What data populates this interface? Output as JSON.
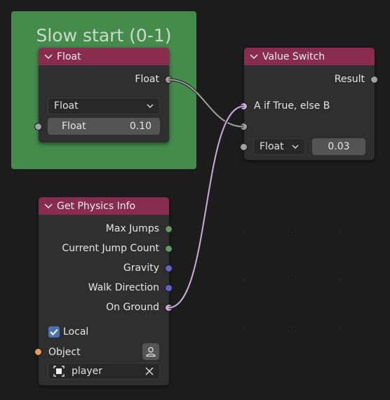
{
  "frame": {
    "title": "Slow start (0-1)"
  },
  "float_node": {
    "title": "Float",
    "output_label": "Float",
    "type_select": "Float",
    "value_label": "Float",
    "value": "0.10"
  },
  "value_switch": {
    "title": "Value Switch",
    "output_label": "Result",
    "input_a_label": "A if True, else B",
    "type_select": "Float",
    "value": "0.03"
  },
  "physics": {
    "title": "Get Physics Info",
    "outputs": [
      "Max Jumps",
      "Current Jump Count",
      "Gravity",
      "Walk Direction",
      "On Ground"
    ],
    "local_label": "Local",
    "object_label": "Object",
    "object_value": "player"
  },
  "colors": {
    "header": "#8a2c4d",
    "frame": "#458b4c",
    "link_gray": "#a1a1a1",
    "link_pink": "#ccaadd"
  }
}
